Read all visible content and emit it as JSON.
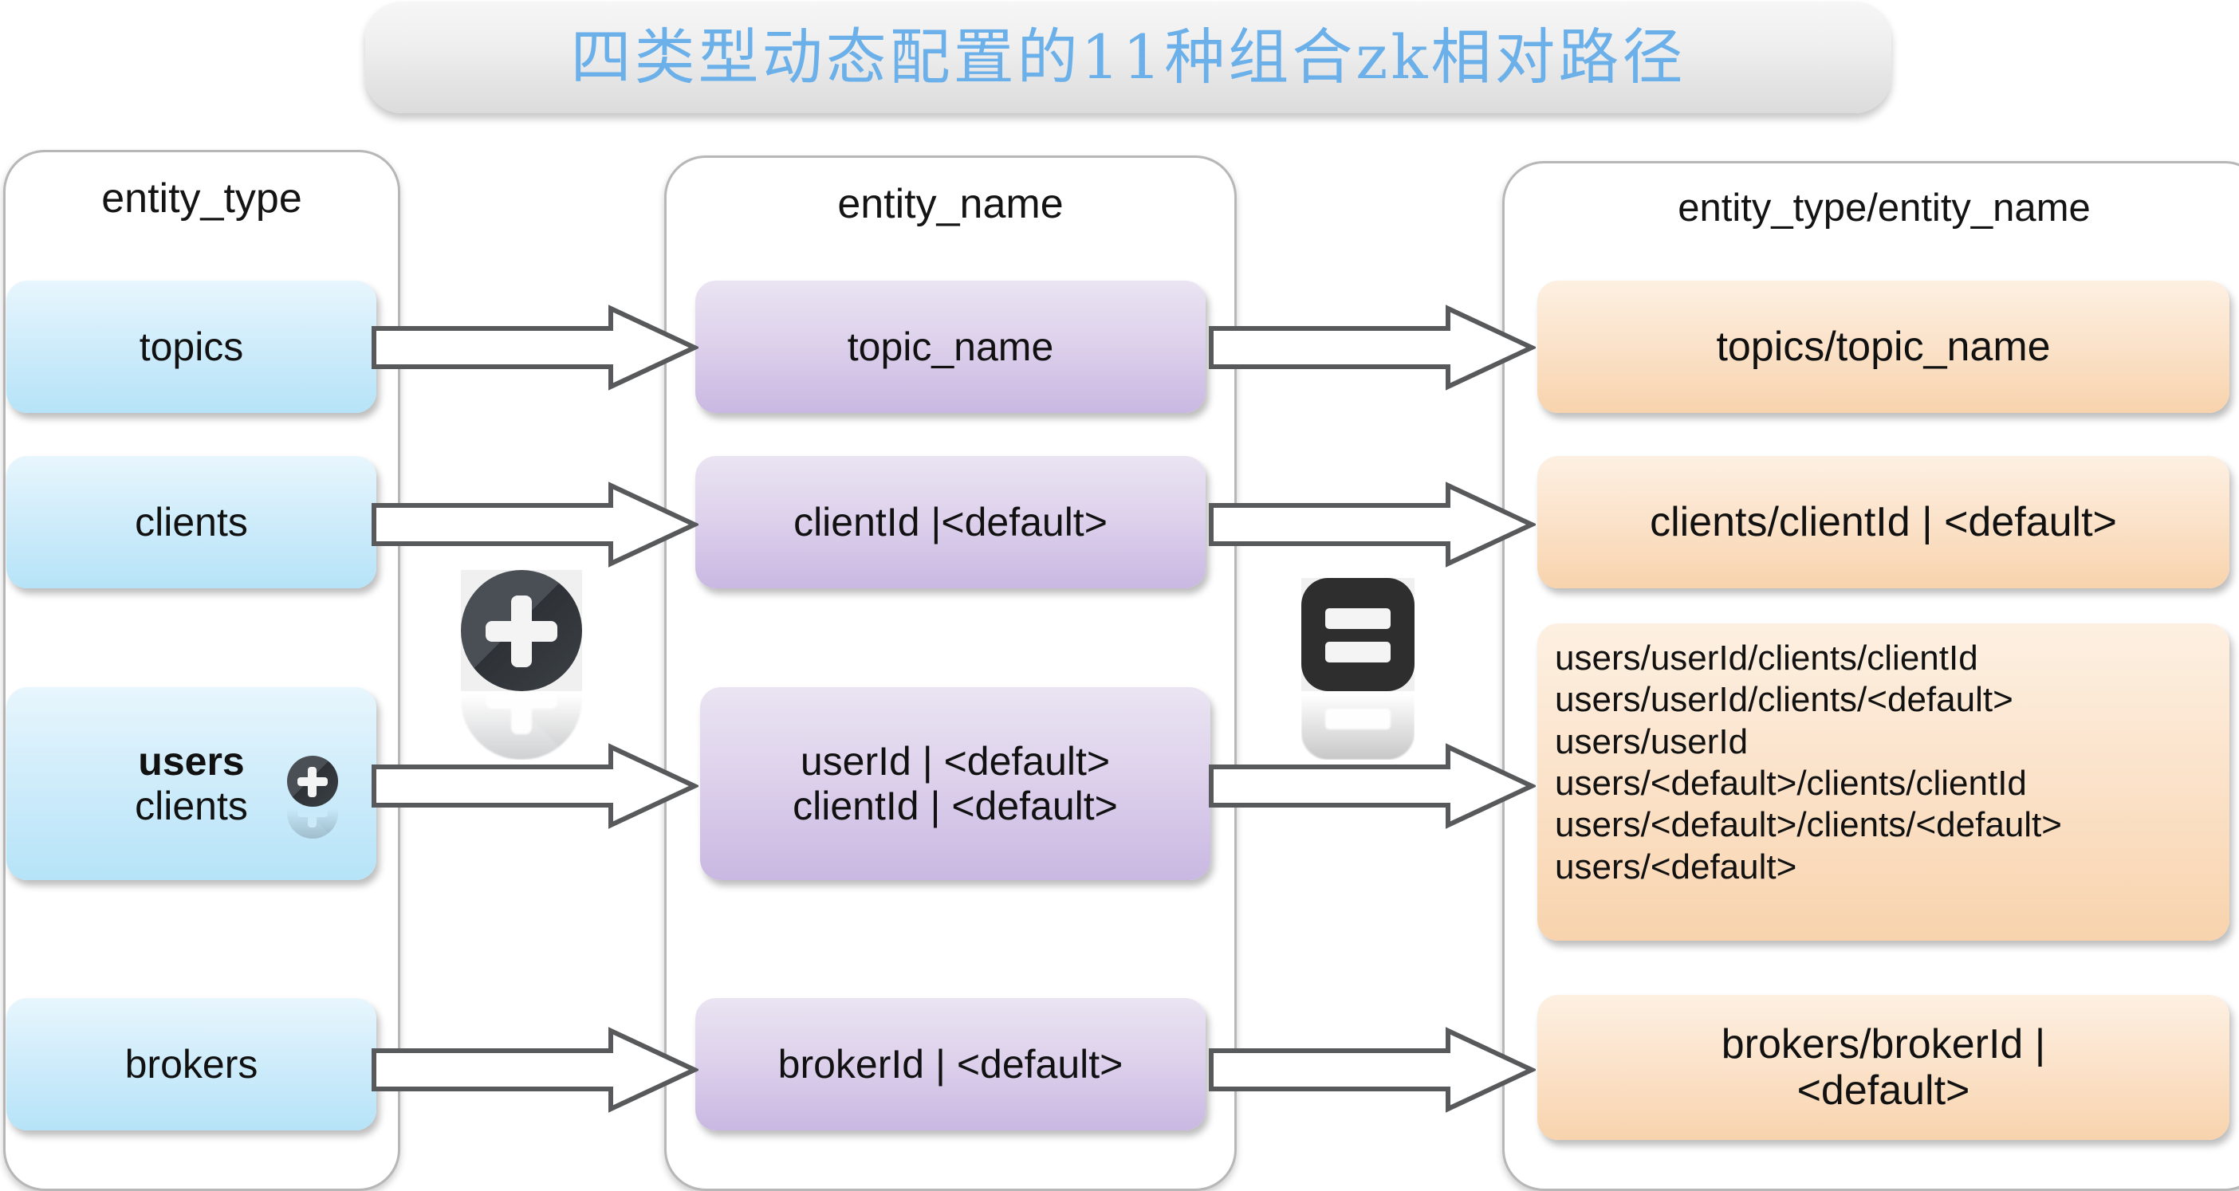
{
  "title": {
    "text": "四类型动态配置的11种组合zk相对路径",
    "color": "#6cb0ea"
  },
  "columns": {
    "entity_type": {
      "heading": "entity_type",
      "boxes": [
        {
          "label": "topics"
        },
        {
          "label": "clients"
        },
        {
          "label_primary": "users",
          "label_secondary": "clients",
          "badge": "plus-icon"
        },
        {
          "label": "brokers"
        }
      ]
    },
    "entity_name": {
      "heading": "entity_name",
      "boxes": [
        {
          "label": "topic_name"
        },
        {
          "label": "clientId |<default>"
        },
        {
          "line1": "userId | <default>",
          "line2": "clientId | <default>"
        },
        {
          "label": "brokerId | <default>"
        }
      ]
    },
    "combined": {
      "heading": "entity_type/entity_name",
      "boxes": [
        {
          "label": "topics/topic_name"
        },
        {
          "label": "clients/clientId | <default>"
        },
        {
          "lines": [
            "users/userId/clients/clientId",
            "users/userId/clients/<default>",
            "users/userId",
            "users/<default>/clients/clientId",
            "users/<default>/clients/<default>",
            "users/<default>"
          ]
        },
        {
          "line1": "brokers/brokerId |",
          "line2": "<default>"
        }
      ]
    }
  },
  "operators": {
    "plus": "plus-circle-icon",
    "equals": "equals-square-icon"
  },
  "arrows": {
    "count_left": 4,
    "count_right": 4,
    "style": "block-arrow-right"
  },
  "colors": {
    "box_blue": "#b6e3f8",
    "box_purple": "#c9b8e2",
    "box_orange": "#f8d3ad",
    "panel_border": "#b7b7b7",
    "arrow_stroke": "#58595b",
    "title_blue": "#6cb0ea"
  }
}
